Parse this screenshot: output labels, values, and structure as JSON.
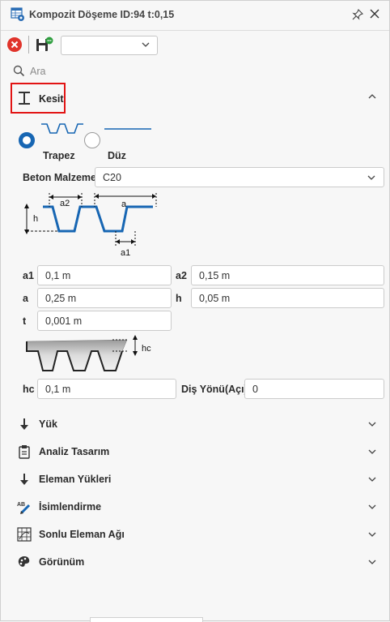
{
  "window": {
    "title": "Kompozit Döşeme ID:94 t:0,15",
    "icons": [
      "table-settings-icon",
      "pin-icon",
      "close-icon"
    ]
  },
  "toolbar": {
    "dropdown_value": ""
  },
  "search": {
    "placeholder": "Ara"
  },
  "kesit": {
    "label": "Kesit",
    "options": [
      {
        "label": "Trapez",
        "selected": true
      },
      {
        "label": "Düz",
        "selected": false
      }
    ],
    "beton_label": "Beton Malzeme",
    "beton_value": "C20",
    "diagram_labels": {
      "a2": "a2",
      "a": "a",
      "h": "h",
      "a1": "a1",
      "hc": "hc"
    },
    "fields": {
      "a1": {
        "label": "a1",
        "value": "0,1 m"
      },
      "a2": {
        "label": "a2",
        "value": "0,15 m"
      },
      "a": {
        "label": "a",
        "value": "0,25 m"
      },
      "h": {
        "label": "h",
        "value": "0,05 m"
      },
      "t": {
        "label": "t",
        "value": "0,001 m"
      },
      "hc": {
        "label": "hc",
        "value": "0,1 m"
      },
      "dis_yonu": {
        "label": "Diş Yönü(Açı)",
        "value": "0"
      }
    }
  },
  "sections": [
    {
      "label": "Yük",
      "icon": "down-arrow-icon"
    },
    {
      "label": "Analiz Tasarım",
      "icon": "clipboard-icon"
    },
    {
      "label": "Eleman Yükleri",
      "icon": "down-arrow-icon"
    },
    {
      "label": "İsimlendirme",
      "icon": "rename-pencil-icon"
    },
    {
      "label": "Sonlu Eleman Ağı",
      "icon": "mesh-grid-icon"
    },
    {
      "label": "Görünüm",
      "icon": "palette-icon"
    }
  ],
  "colors": {
    "accent": "#1766b3",
    "highlight": "#e21414",
    "close_button": "#e0342b"
  }
}
